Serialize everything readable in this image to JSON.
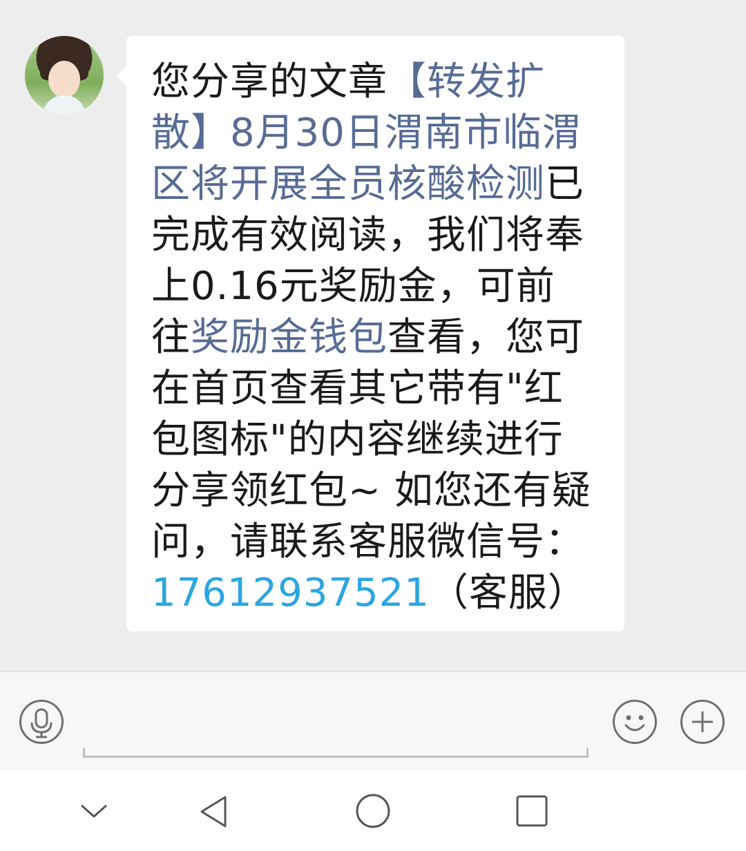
{
  "chat": {
    "sender_avatar_icon": "girl-avatar-icon",
    "message": {
      "segments": [
        {
          "text": "您分享的文章",
          "style": "normal"
        },
        {
          "text": "【转发扩散】8月30日渭南市临渭区将开展全员核酸检测",
          "style": "link"
        },
        {
          "text": "已完成有效阅读，我们将奉上0.16元奖励金，可前往",
          "style": "normal"
        },
        {
          "text": "奖励金钱包",
          "style": "link"
        },
        {
          "text": "查看，您可在首页查看其它带有\"红包图标\"的内容继续进行分享领红包~ 如您还有疑问，请联系客服微信号：",
          "style": "normal"
        },
        {
          "text": "17612937521",
          "style": "phone"
        },
        {
          "text": "（客服）",
          "style": "normal"
        }
      ]
    }
  },
  "input_bar": {
    "voice_icon": "microphone-icon",
    "emoji_icon": "smiley-icon",
    "more_icon": "plus-icon",
    "text_value": ""
  },
  "nav_bar": {
    "icons": [
      "chevron-down-icon",
      "back-triangle-icon",
      "home-circle-icon",
      "recent-square-icon"
    ]
  },
  "colors": {
    "link": "#576b95",
    "phone": "#2aa6e0",
    "background": "#ededed",
    "bubble": "#ffffff"
  }
}
